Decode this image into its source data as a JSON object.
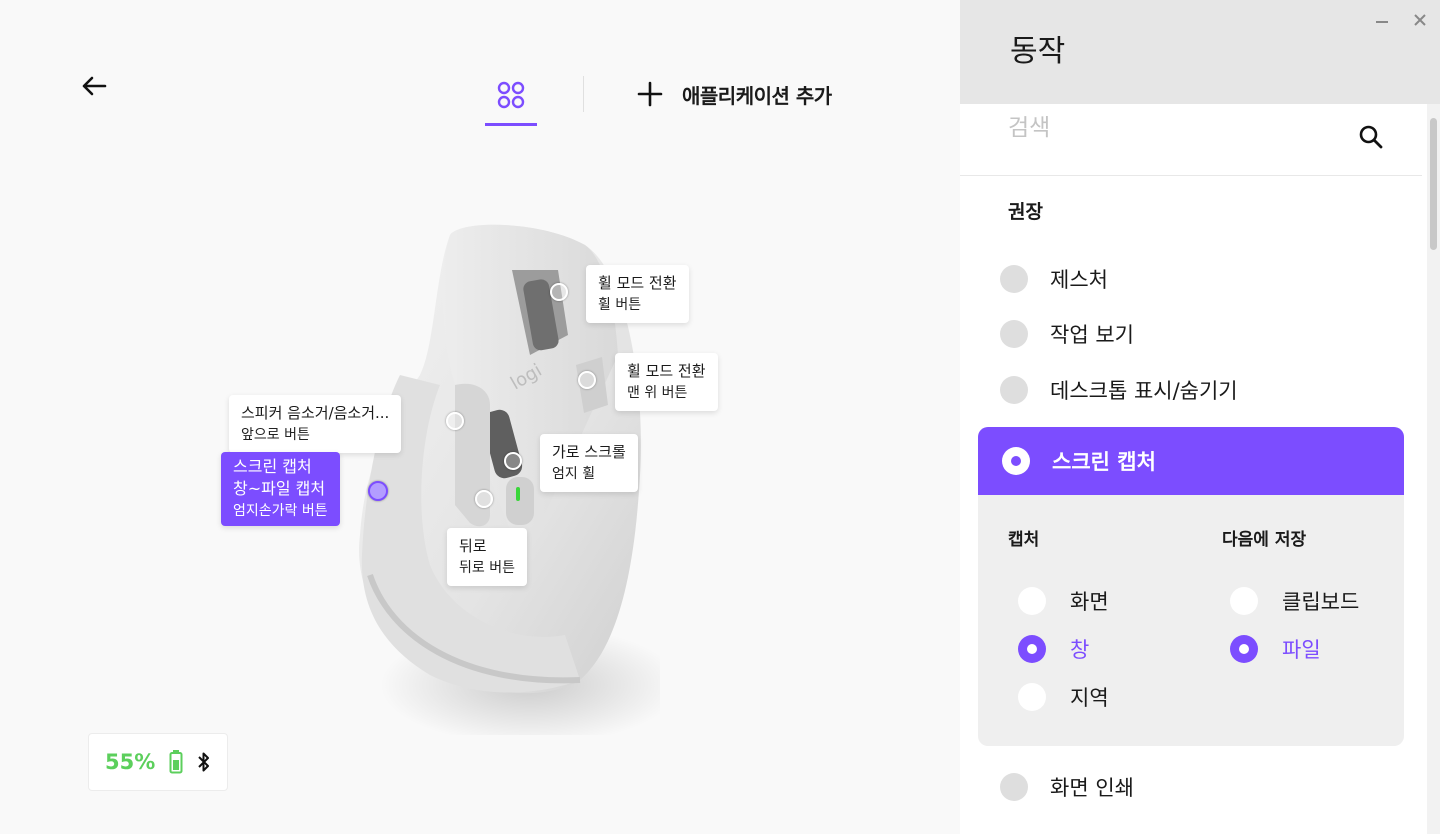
{
  "nav": {
    "add_app_label": "애플리케이션 추가"
  },
  "mouse": {
    "callouts": [
      {
        "title": "휠 모드 전환",
        "sub": "휠 버튼"
      },
      {
        "title": "휠 모드 전환",
        "sub": "맨 위 버튼"
      },
      {
        "title": "스피커 음소거/음소거...",
        "sub": "앞으로 버튼"
      },
      {
        "title": "가로 스크롤",
        "sub": "엄지 휠"
      },
      {
        "title": "스크린 캡처",
        "sub1": "창~파일 캡처",
        "sub": "엄지손가락 버튼"
      },
      {
        "title": "뒤로",
        "sub": "뒤로 버튼"
      }
    ],
    "logo_text": "logi"
  },
  "status": {
    "battery_percent": "55%",
    "battery_color": "#5ccf5c",
    "connection_icon": "bluetooth-icon"
  },
  "panel": {
    "title": "동작",
    "search_placeholder": "검색",
    "section_title": "권장",
    "actions": [
      {
        "label": "제스처"
      },
      {
        "label": "작업 보기"
      },
      {
        "label": "데스크톱 표시/숨기기"
      },
      {
        "label": "스크린 캡처",
        "selected": true
      },
      {
        "label": "화면 인쇄"
      }
    ],
    "capture": {
      "capture_title": "캡처",
      "capture_options": [
        "화면",
        "창",
        "지역"
      ],
      "capture_selected": "창",
      "save_title": "다음에 저장",
      "save_options": [
        "클립보드",
        "파일"
      ],
      "save_selected": "파일"
    },
    "accent_color": "#7c4dff"
  }
}
